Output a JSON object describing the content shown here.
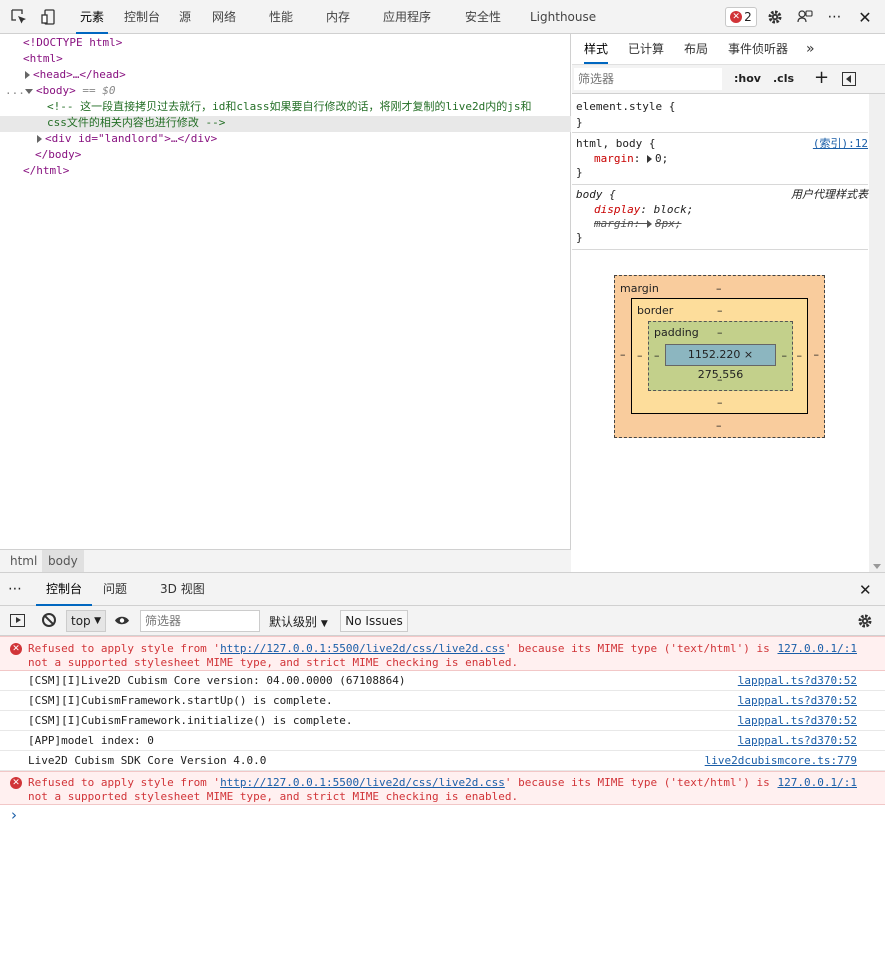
{
  "toolbar": {
    "tabs": [
      "元素",
      "控制台",
      "源",
      "网络",
      "性能",
      "内存",
      "应用程序",
      "安全性",
      "Lighthouse"
    ],
    "error_count": "2"
  },
  "dom": {
    "lines": [
      "<!DOCTYPE html>",
      "<html>",
      "<head>…</head>",
      "<body>",
      "== $0",
      "<!--  这一段直接拷贝过去就行，id和class如果要自行修改的话，将刚才复制的live2d内的js和",
      "css文件的相关内容也进行修改  -->",
      "<div id=\"landlord\">…</div>",
      "</body>",
      "</html>"
    ],
    "gutter": "..."
  },
  "breadcrumbs": [
    "html",
    "body"
  ],
  "styles": {
    "tabs": [
      "样式",
      "已计算",
      "布局",
      "事件侦听器",
      "»"
    ],
    "filter_placeholder": "筛选器",
    "hov": ":hov",
    "cls": ".cls",
    "rules": [
      {
        "selector": "element.style {",
        "close": "}"
      },
      {
        "selector": "html, body {",
        "source": "(索引):12",
        "prop": "margin",
        "value": "0;",
        "close": "}"
      },
      {
        "selector": "body {",
        "source": "用户代理样式表",
        "prop1": "display",
        "value1": "block;",
        "prop2": "margin",
        "value2": "8px;",
        "close": "}"
      }
    ]
  },
  "boxmodel": {
    "margin": "margin",
    "border": "border",
    "padding": "padding",
    "dash": "–",
    "content": "1152.220 × 275.556"
  },
  "drawer": {
    "tabs": [
      "控制台",
      "问题",
      "3D 视图"
    ],
    "context": "top",
    "filter_placeholder": "筛选器",
    "level": "默认级别",
    "issues": "No Issues"
  },
  "console": {
    "messages": [
      {
        "type": "error",
        "line1_pre": "Refused to apply style from '",
        "url": "http://127.0.0.1:5500/live2d/css/live2d.css",
        "line1_post": "' because its MIME type ('text/html') is",
        "line2": "not a supported stylesheet MIME type, and strict MIME checking is enabled.",
        "source": "127.0.0.1/:1"
      },
      {
        "type": "log",
        "text": "[CSM][I]Live2D Cubism Core version: 04.00.0000 (67108864)",
        "source": "lapppal.ts?d370:52"
      },
      {
        "type": "log",
        "text": "[CSM][I]CubismFramework.startUp() is complete.",
        "source": "lapppal.ts?d370:52"
      },
      {
        "type": "log",
        "text": "[CSM][I]CubismFramework.initialize() is complete.",
        "source": "lapppal.ts?d370:52"
      },
      {
        "type": "log",
        "text": "[APP]model index: 0",
        "source": "lapppal.ts?d370:52"
      },
      {
        "type": "log",
        "text": "Live2D Cubism SDK Core Version 4.0.0",
        "source": "live2dcubismcore.ts:779"
      },
      {
        "type": "error",
        "line1_pre": "Refused to apply style from '",
        "url": "http://127.0.0.1:5500/live2d/css/live2d.css",
        "line1_post": "' because its MIME type ('text/html') is",
        "line2": "not a supported stylesheet MIME type, and strict MIME checking is enabled.",
        "source": "127.0.0.1/:1"
      }
    ],
    "prompt": "›"
  }
}
